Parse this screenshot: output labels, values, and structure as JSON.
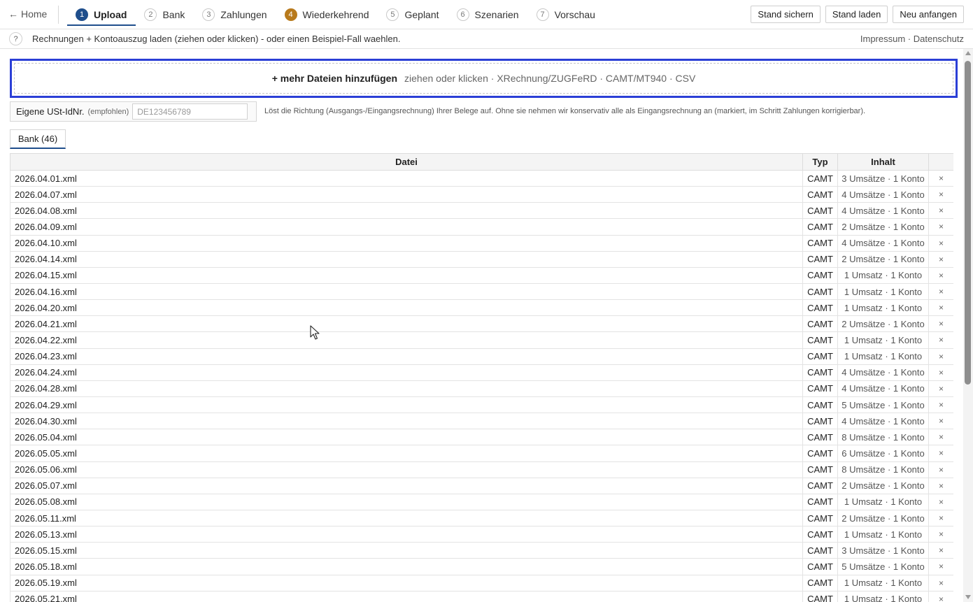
{
  "nav": {
    "home": "Home",
    "steps": [
      {
        "num": "1",
        "label": "Upload"
      },
      {
        "num": "2",
        "label": "Bank"
      },
      {
        "num": "3",
        "label": "Zahlungen"
      },
      {
        "num": "4",
        "label": "Wiederkehrend"
      },
      {
        "num": "5",
        "label": "Geplant"
      },
      {
        "num": "6",
        "label": "Szenarien"
      },
      {
        "num": "7",
        "label": "Vorschau"
      }
    ],
    "active_step": "Upload",
    "warn_step": "Wiederkehrend",
    "actions": {
      "save": "Stand sichern",
      "load": "Stand laden",
      "restart": "Neu anfangen"
    }
  },
  "hintbar": {
    "help": "?",
    "text": "Rechnungen + Kontoauszug laden (ziehen oder klicken) - oder einen Beispiel-Fall waehlen.",
    "impressum": "Impressum",
    "separator": " · ",
    "datenschutz": "Datenschutz"
  },
  "dropzone": {
    "main": "+ mehr Dateien hinzufügen",
    "sub": "ziehen oder klicken · XRechnung/ZUGFeRD · CAMT/MT940 · CSV"
  },
  "vat": {
    "label": "Eigene USt-IdNr.",
    "small": "(empfohlen)",
    "placeholder": "DE123456789",
    "note": "Löst die Richtung (Ausgangs-/Eingangsrechnung) Ihrer Belege auf. Ohne sie nehmen wir konservativ alle als Eingangsrechnung an (markiert, im Schritt Zahlungen korrigierbar)."
  },
  "tab": {
    "label": "Bank (46)"
  },
  "table": {
    "headers": {
      "file": "Datei",
      "type": "Typ",
      "content": "Inhalt"
    },
    "delete_symbol": "×",
    "rows": [
      {
        "file": "2026.04.01.xml",
        "type": "CAMT",
        "content": "3 Umsätze · 1 Konto"
      },
      {
        "file": "2026.04.07.xml",
        "type": "CAMT",
        "content": "4 Umsätze · 1 Konto"
      },
      {
        "file": "2026.04.08.xml",
        "type": "CAMT",
        "content": "4 Umsätze · 1 Konto"
      },
      {
        "file": "2026.04.09.xml",
        "type": "CAMT",
        "content": "2 Umsätze · 1 Konto"
      },
      {
        "file": "2026.04.10.xml",
        "type": "CAMT",
        "content": "4 Umsätze · 1 Konto"
      },
      {
        "file": "2026.04.14.xml",
        "type": "CAMT",
        "content": "2 Umsätze · 1 Konto"
      },
      {
        "file": "2026.04.15.xml",
        "type": "CAMT",
        "content": "1 Umsatz · 1 Konto"
      },
      {
        "file": "2026.04.16.xml",
        "type": "CAMT",
        "content": "1 Umsatz · 1 Konto"
      },
      {
        "file": "2026.04.20.xml",
        "type": "CAMT",
        "content": "1 Umsatz · 1 Konto"
      },
      {
        "file": "2026.04.21.xml",
        "type": "CAMT",
        "content": "2 Umsätze · 1 Konto"
      },
      {
        "file": "2026.04.22.xml",
        "type": "CAMT",
        "content": "1 Umsatz · 1 Konto"
      },
      {
        "file": "2026.04.23.xml",
        "type": "CAMT",
        "content": "1 Umsatz · 1 Konto"
      },
      {
        "file": "2026.04.24.xml",
        "type": "CAMT",
        "content": "4 Umsätze · 1 Konto"
      },
      {
        "file": "2026.04.28.xml",
        "type": "CAMT",
        "content": "4 Umsätze · 1 Konto"
      },
      {
        "file": "2026.04.29.xml",
        "type": "CAMT",
        "content": "5 Umsätze · 1 Konto"
      },
      {
        "file": "2026.04.30.xml",
        "type": "CAMT",
        "content": "4 Umsätze · 1 Konto"
      },
      {
        "file": "2026.05.04.xml",
        "type": "CAMT",
        "content": "8 Umsätze · 1 Konto"
      },
      {
        "file": "2026.05.05.xml",
        "type": "CAMT",
        "content": "6 Umsätze · 1 Konto"
      },
      {
        "file": "2026.05.06.xml",
        "type": "CAMT",
        "content": "8 Umsätze · 1 Konto"
      },
      {
        "file": "2026.05.07.xml",
        "type": "CAMT",
        "content": "2 Umsätze · 1 Konto"
      },
      {
        "file": "2026.05.08.xml",
        "type": "CAMT",
        "content": "1 Umsatz · 1 Konto"
      },
      {
        "file": "2026.05.11.xml",
        "type": "CAMT",
        "content": "2 Umsätze · 1 Konto"
      },
      {
        "file": "2026.05.13.xml",
        "type": "CAMT",
        "content": "1 Umsatz · 1 Konto"
      },
      {
        "file": "2026.05.15.xml",
        "type": "CAMT",
        "content": "3 Umsätze · 1 Konto"
      },
      {
        "file": "2026.05.18.xml",
        "type": "CAMT",
        "content": "5 Umsätze · 1 Konto"
      },
      {
        "file": "2026.05.19.xml",
        "type": "CAMT",
        "content": "1 Umsatz · 1 Konto"
      },
      {
        "file": "2026.05.21.xml",
        "type": "CAMT",
        "content": "1 Umsatz · 1 Konto"
      }
    ]
  },
  "colors": {
    "accent": "#1f4e8c",
    "warning": "#b87a1c",
    "dropzone_border": "#2b3fd6"
  }
}
